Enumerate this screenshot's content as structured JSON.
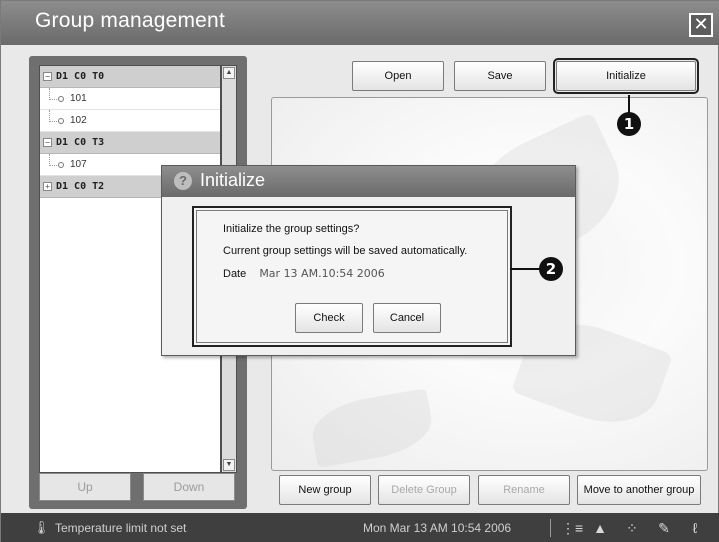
{
  "window": {
    "title": "Group management",
    "close_glyph": "✕"
  },
  "tree": {
    "groups": [
      {
        "label": "D1 C0 T0",
        "toggle": "−",
        "items": [
          "101",
          "102"
        ]
      },
      {
        "label": "D1 C0 T3",
        "toggle": "−",
        "items": [
          "107"
        ]
      },
      {
        "label": "D1 C0 T2",
        "toggle": "+",
        "items": []
      }
    ]
  },
  "left_buttons": {
    "up": "Up",
    "down": "Down"
  },
  "top_buttons": {
    "open": "Open",
    "save": "Save",
    "initialize": "Initialize"
  },
  "bottom_buttons": {
    "new_group": "New group",
    "delete_group": "Delete Group",
    "rename": "Rename",
    "move": "Move to another group"
  },
  "callouts": {
    "one": "1",
    "two": "2"
  },
  "dialog": {
    "title": "Initialize",
    "icon": "?",
    "line1": "Initialize the group settings?",
    "line2": "Current group settings will be saved automatically.",
    "date_label": "Date",
    "date_value": "Mar 13 AM.10:54 2006",
    "check": "Check",
    "cancel": "Cancel"
  },
  "status": {
    "message": "Temperature limit not set",
    "time": "Mon Mar 13 AM 10:54 2006"
  },
  "icons": {
    "status": "thermometer-icon",
    "tray": [
      "schedule-icon",
      "warning-icon",
      "dots-icon",
      "pen-icon",
      "signal-icon"
    ]
  },
  "colors": {
    "titlebar": "#7a7a7a",
    "statusbar": "#3f3f3f",
    "panel": "#6f6f6f"
  }
}
